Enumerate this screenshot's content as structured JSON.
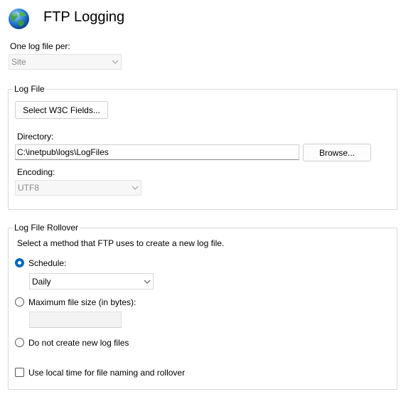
{
  "header": {
    "title": "FTP Logging",
    "icon": "globe-icon"
  },
  "log_file_per": {
    "label": "One log file per:",
    "value": "Site"
  },
  "log_file": {
    "legend": "Log File",
    "select_fields_button": "Select W3C Fields...",
    "directory_label": "Directory:",
    "directory_value": "C:\\inetpub\\logs\\LogFiles",
    "browse_button": "Browse...",
    "encoding_label": "Encoding:",
    "encoding_value": "UTF8"
  },
  "rollover": {
    "legend": "Log File Rollover",
    "description": "Select a method that FTP uses to create a new log file.",
    "schedule_label": "Schedule:",
    "schedule_value": "Daily",
    "max_size_label": "Maximum file size (in bytes):",
    "max_size_value": "",
    "no_new_label": "Do not create new log files",
    "local_time_label": "Use local time for file naming and rollover",
    "selected_option": "Schedule",
    "local_time_checked": false
  },
  "colors": {
    "accent": "#0067c0",
    "disabled_text": "#8a8a8a"
  }
}
